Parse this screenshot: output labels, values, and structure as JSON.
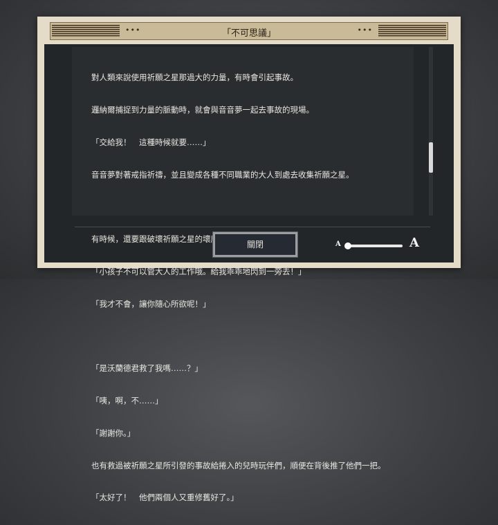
{
  "dialog": {
    "title": "「不可思議」",
    "header_dots_left": "•••",
    "header_dots_right": "•••",
    "lines": [
      "對人類來說使用祈願之星那過大的力量，有時會引起事故。",
      "邏納爾捕捉到力量的脈動時，就會與音音夢一起去事故的現場。",
      "「交給我！　這種時候就要……」",
      "音音夢對著戒指祈禱，並且變成各種不同職業的大人到處去收集祈願之星。",
      "",
      "有時候，還要跟破壞祈願之星的壞魔女手下對抗。",
      "「小孩子不可以管大人的工作哦。給我乖乖地閃到一旁去！」",
      "「我才不會，讓你隨心所欲呢！」",
      "",
      "「是沃蘭德君救了我嗎……？」",
      "「咦，啊，不……」",
      "「謝謝你。」",
      "也有救過被祈願之星所引發的事故給捲入的兒時玩伴們，順便在背後推了他們一把。",
      "「太好了！　他們兩個人又重修舊好了。」"
    ],
    "close_label": "關閉",
    "font_size_small_label": "A",
    "font_size_large_label": "A",
    "font_size_level": 0,
    "scroll_position": 0.62
  }
}
